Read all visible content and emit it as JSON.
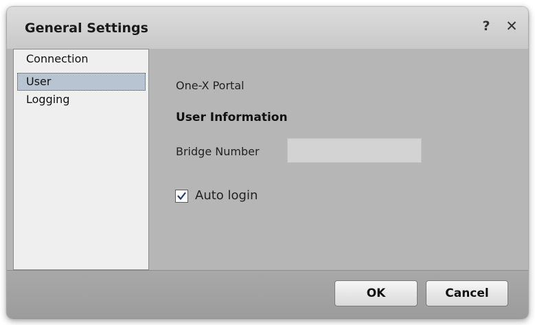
{
  "dialog": {
    "title": "General Settings",
    "help_glyph": "?",
    "close_glyph": "✕"
  },
  "sidebar": {
    "items": [
      {
        "label": "Connection",
        "selected": false
      },
      {
        "label": "User",
        "selected": true
      },
      {
        "label": "Logging",
        "selected": false
      }
    ]
  },
  "content": {
    "portal_label": "One-X Portal",
    "section_heading": "User Information",
    "bridge_number": {
      "label": "Bridge Number",
      "value": ""
    },
    "auto_login": {
      "label": "Auto login",
      "checked": true
    }
  },
  "footer": {
    "ok_label": "OK",
    "cancel_label": "Cancel"
  }
}
